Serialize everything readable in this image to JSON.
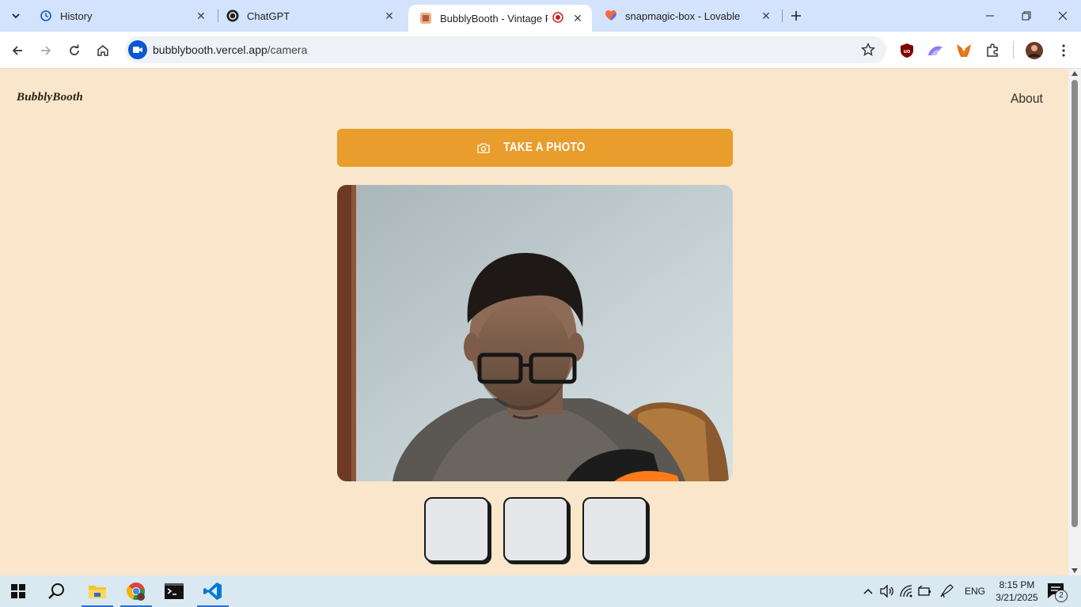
{
  "browser": {
    "tabs": [
      {
        "title": "History",
        "icon": "history-icon",
        "active": false
      },
      {
        "title": "ChatGPT",
        "icon": "chatgpt-icon",
        "active": false
      },
      {
        "title": "BubblyBooth - Vintage Photo",
        "icon": "bubblybooth-icon",
        "active": true
      },
      {
        "title": "snapmagic-box - Lovable",
        "icon": "lovable-heart-icon",
        "active": false
      }
    ],
    "address": {
      "host": "bubblybooth.vercel.app",
      "path": "/camera"
    }
  },
  "page": {
    "logo": "BubblyBooth",
    "nav_about": "About",
    "take_photo_label": "TAKE A PHOTO",
    "thumbnail_count": 3
  },
  "taskbar": {
    "language": "ENG",
    "time": "8:15 PM",
    "date": "3/21/2025",
    "notification_count": "2"
  },
  "colors": {
    "page_background": "#fae6ca",
    "button_accent": "#e89d2c",
    "tab_strip": "#d3e3fd"
  }
}
